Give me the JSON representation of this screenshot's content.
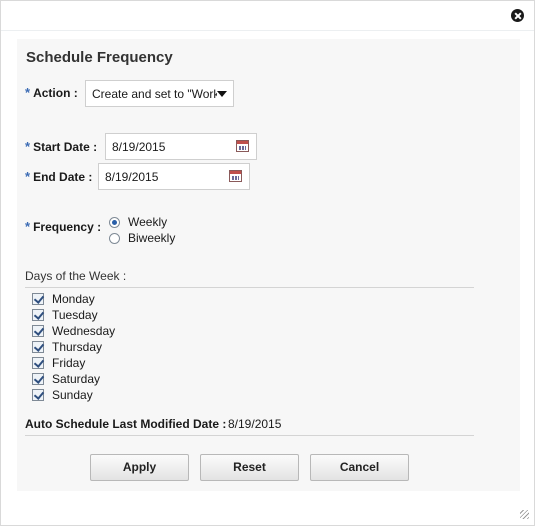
{
  "dialog": {
    "title": "Schedule Frequency",
    "required_marker": "*"
  },
  "action": {
    "label": "Action :",
    "value": "Create and set to \"Worksheet\""
  },
  "start_date": {
    "label": "Start Date :",
    "value": "8/19/2015"
  },
  "end_date": {
    "label": "End Date :",
    "value": "8/19/2015"
  },
  "frequency": {
    "label": "Frequency :",
    "options": [
      {
        "label": "Weekly",
        "selected": true
      },
      {
        "label": "Biweekly",
        "selected": false
      }
    ]
  },
  "days_of_week": {
    "label": "Days of the Week :",
    "days": [
      {
        "label": "Monday",
        "checked": true
      },
      {
        "label": "Tuesday",
        "checked": true
      },
      {
        "label": "Wednesday",
        "checked": true
      },
      {
        "label": "Thursday",
        "checked": true
      },
      {
        "label": "Friday",
        "checked": true
      },
      {
        "label": "Saturday",
        "checked": true
      },
      {
        "label": "Sunday",
        "checked": true
      }
    ]
  },
  "last_modified": {
    "label": "Auto Schedule Last Modified Date :",
    "value": "8/19/2015"
  },
  "buttons": {
    "apply": "Apply",
    "reset": "Reset",
    "cancel": "Cancel"
  },
  "icons": {
    "close": "close-icon",
    "calendar": "calendar-icon",
    "dropdown": "chevron-down-icon",
    "resize": "resize-grip-icon"
  },
  "colors": {
    "required": "#3b6bb4",
    "panel": "#f7f7f7",
    "radio_selected": "#2a5fa8"
  }
}
